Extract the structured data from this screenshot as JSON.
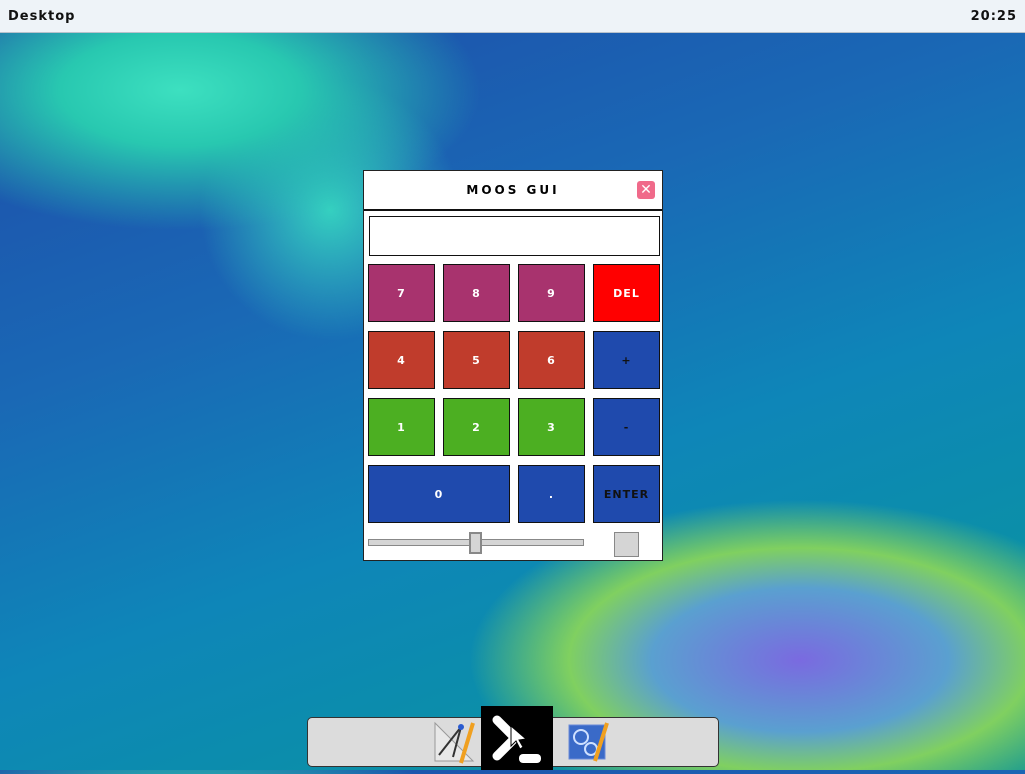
{
  "topbar": {
    "title": "Desktop",
    "clock": "20:25"
  },
  "window": {
    "title": "MOOS GUI",
    "close_icon": "close-icon",
    "display_value": "",
    "buttons": [
      {
        "label": "7",
        "color": "#a8336e"
      },
      {
        "label": "8",
        "color": "#a8336e"
      },
      {
        "label": "9",
        "color": "#a8336e"
      },
      {
        "label": "DEL",
        "color": "#ff0000"
      },
      {
        "label": "4",
        "color": "#c03c2c"
      },
      {
        "label": "5",
        "color": "#c03c2c"
      },
      {
        "label": "6",
        "color": "#c03c2c"
      },
      {
        "label": "+",
        "color": "#1f4aad"
      },
      {
        "label": "1",
        "color": "#4caf22"
      },
      {
        "label": "2",
        "color": "#4caf22"
      },
      {
        "label": "3",
        "color": "#4caf22"
      },
      {
        "label": "-",
        "color": "#1f4aad"
      },
      {
        "label": "0",
        "color": "#1f4aad"
      },
      {
        "label": ".",
        "color": "#1f4aad"
      },
      {
        "label": "ENTER",
        "color": "#1f4aad"
      }
    ],
    "slider_value_percent": 50,
    "checkbox_checked": false
  },
  "dock": {
    "items": [
      "drafting-tools-icon",
      "terminal-icon",
      "settings-blueprint-icon"
    ]
  }
}
